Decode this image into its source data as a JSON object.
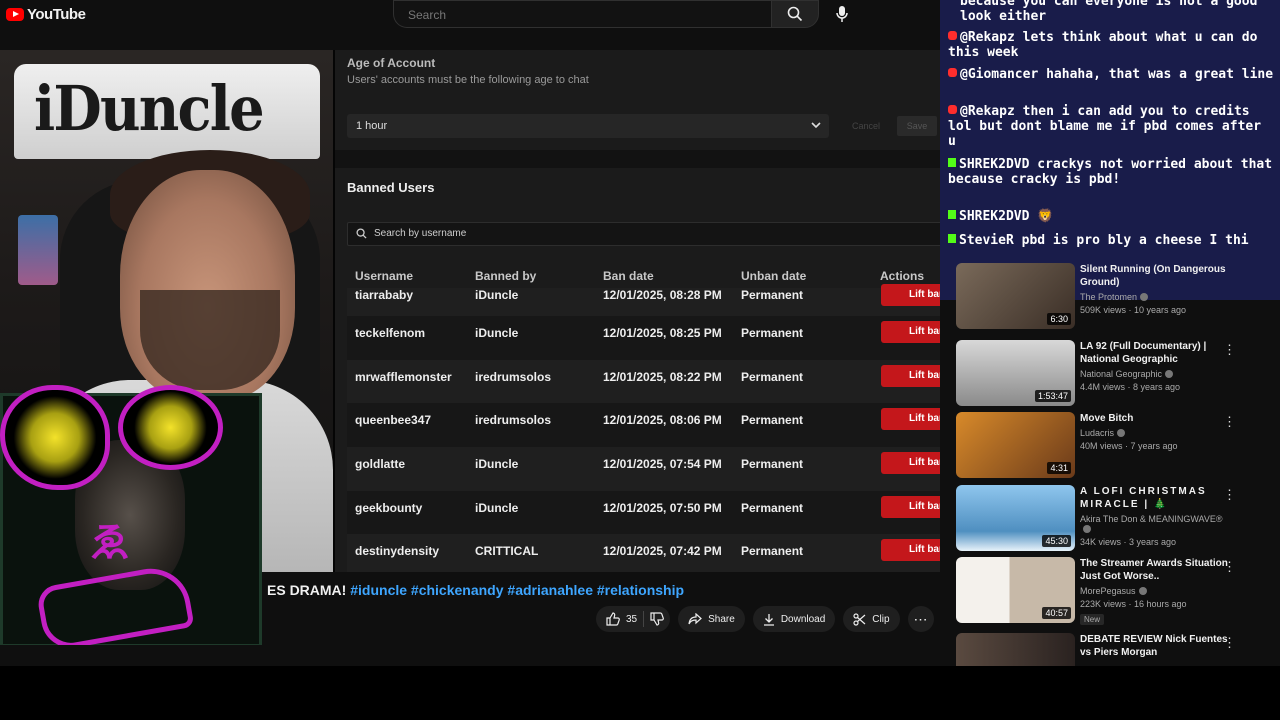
{
  "header": {
    "logo_text": "YouTube",
    "search_placeholder": "Search"
  },
  "studio": {
    "age_title": "Age of Account",
    "age_subtitle": "Users' accounts must be the following age to chat",
    "age_value": "1 hour",
    "cancel_label": "Cancel",
    "save_label": "Save",
    "banned_title": "Banned Users",
    "search_placeholder": "Search by username",
    "columns": [
      "Username",
      "Banned by",
      "Ban date",
      "Unban date",
      "Actions"
    ],
    "lift_label": "Lift ban",
    "rows": [
      {
        "username": "tiarrababy",
        "banned_by": "iDuncle",
        "ban_date": "12/01/2025, 08:28 PM",
        "unban": "Permanent"
      },
      {
        "username": "teckelfenom",
        "banned_by": "iDuncle",
        "ban_date": "12/01/2025, 08:25 PM",
        "unban": "Permanent"
      },
      {
        "username": "mrwafflemonster",
        "banned_by": "iredrumsolos",
        "ban_date": "12/01/2025, 08:22 PM",
        "unban": "Permanent"
      },
      {
        "username": "queenbee347",
        "banned_by": "iredrumsolos",
        "ban_date": "12/01/2025, 08:06 PM",
        "unban": "Permanent"
      },
      {
        "username": "goldlatte",
        "banned_by": "iDuncle",
        "ban_date": "12/01/2025, 07:54 PM",
        "unban": "Permanent"
      },
      {
        "username": "geekbounty",
        "banned_by": "iDuncle",
        "ban_date": "12/01/2025, 07:50 PM",
        "unban": "Permanent"
      },
      {
        "username": "destinydensity",
        "banned_by": "CRITTICAL",
        "ban_date": "12/01/2025, 07:42 PM",
        "unban": "Permanent"
      }
    ]
  },
  "webcam": {
    "sign_text": "iDuncle"
  },
  "video": {
    "title_prefix": "ES DRAMA!",
    "title_tags": "#iduncle #chickenandy #adrianahlee #relationship",
    "like_count": "35",
    "share_label": "Share",
    "download_label": "Download",
    "clip_label": "Clip"
  },
  "chat": {
    "messages": [
      {
        "platform": "youtube",
        "user": "",
        "text": "because you can everyone is not a good look either"
      },
      {
        "platform": "youtube",
        "user": "@Rekapz",
        "text": "lets think about what u can do this week"
      },
      {
        "platform": "youtube",
        "user": "@Giomancer",
        "text": "hahaha, that was a great line"
      },
      {
        "platform": "youtube",
        "user": "@Rekapz",
        "text": "then i can add you to credits lol but dont blame me if pbd comes after u"
      },
      {
        "platform": "kick",
        "user": "SHREK2DVD",
        "text": "crackys not worried about that because cracky is pbd!"
      },
      {
        "platform": "kick",
        "user": "SHREK2DVD",
        "text": "🦁"
      },
      {
        "platform": "kick",
        "user": "StevieR",
        "text": "pbd is pro bly a cheese I thi"
      }
    ]
  },
  "recommendations": [
    {
      "title": "Silent Running (On Dangerous Ground)",
      "channel": "The Protomen",
      "stats": "509K views · 10 years ago",
      "duration": "6:30",
      "new": "",
      "thumb_color": "#5b4a3a"
    },
    {
      "title": "LA 92 (Full Documentary) | National Geographic",
      "channel": "National Geographic",
      "stats": "4.4M views · 8 years ago",
      "duration": "1:53:47",
      "new": "",
      "thumb_color": "#bdbdbd"
    },
    {
      "title": "Move Bitch",
      "channel": "Ludacris",
      "stats": "40M views · 7 years ago",
      "duration": "4:31",
      "new": "",
      "thumb_color": "#a8692a"
    },
    {
      "title": "A LOFI CHRISTMAS MIRACLE | 🎄",
      "channel": "Akira The Don & MEANINGWAVE®",
      "stats": "34K views · 3 years ago",
      "duration": "45:30",
      "new": "",
      "thumb_color": "#7fb7e0"
    },
    {
      "title": "The Streamer Awards Situation Just Got Worse..",
      "channel": "MorePegasus",
      "stats": "223K views · 16 hours ago",
      "duration": "40:57",
      "new": "New",
      "thumb_color": "#d9d3cc"
    },
    {
      "title": "DEBATE REVIEW Nick Fuentes vs Piers Morgan",
      "channel": "",
      "stats": "",
      "duration": "",
      "new": "",
      "thumb_color": "#3a2e2a"
    }
  ]
}
